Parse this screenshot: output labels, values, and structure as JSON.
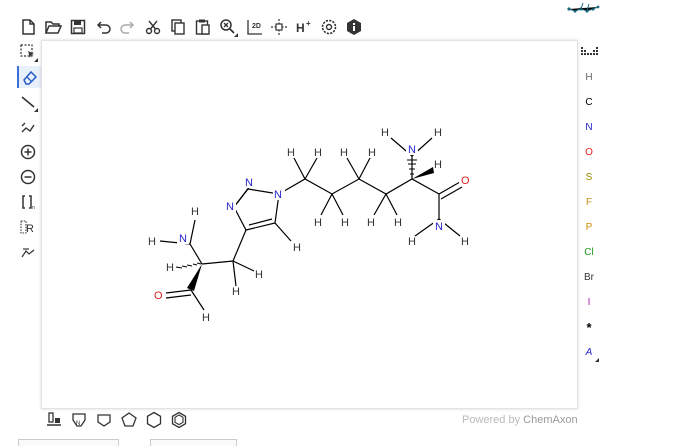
{
  "top_toolbar": {
    "buttons": [
      {
        "name": "new-document-icon"
      },
      {
        "name": "open-folder-icon"
      },
      {
        "name": "save-icon"
      },
      {
        "name": "undo-icon"
      },
      {
        "name": "redo-icon"
      },
      {
        "name": "cut-icon"
      },
      {
        "name": "copy-icon"
      },
      {
        "name": "paste-icon"
      },
      {
        "name": "zoom-icon"
      },
      {
        "name": "clean-2d-icon",
        "label": "2D"
      },
      {
        "name": "aromatize-icon"
      },
      {
        "name": "add-hydrogens-icon",
        "label": "H+"
      },
      {
        "name": "settings-icon"
      },
      {
        "name": "info-icon"
      }
    ]
  },
  "left_toolbar": {
    "tools": [
      {
        "name": "select-tool"
      },
      {
        "name": "erase-tool"
      },
      {
        "name": "single-bond-tool"
      },
      {
        "name": "chain-tool"
      },
      {
        "name": "increase-charge-tool"
      },
      {
        "name": "decrease-charge-tool"
      },
      {
        "name": "sgroup-tool",
        "label": "[ ]n"
      },
      {
        "name": "rgroup-tool",
        "label": "R"
      },
      {
        "name": "reaction-arrow-tool"
      }
    ]
  },
  "atom_palette": {
    "atoms": [
      {
        "symbol": "H",
        "color": "#666666"
      },
      {
        "symbol": "C",
        "color": "#000000"
      },
      {
        "symbol": "N",
        "color": "#2626cc"
      },
      {
        "symbol": "O",
        "color": "#e02020"
      },
      {
        "symbol": "S",
        "color": "#9a8a00"
      },
      {
        "symbol": "F",
        "color": "#c98d18"
      },
      {
        "symbol": "P",
        "color": "#d08a00"
      },
      {
        "symbol": "Cl",
        "color": "#1a9a1a"
      },
      {
        "symbol": "Br",
        "color": "#333333"
      },
      {
        "symbol": "I",
        "color": "#b020b0"
      },
      {
        "symbol": "*",
        "color": "#000000"
      },
      {
        "symbol": "A",
        "color": "#2626cc"
      }
    ]
  },
  "bottom_toolbar": {
    "templates": [
      {
        "name": "template-library-icon"
      },
      {
        "name": "benzene-template-icon"
      },
      {
        "name": "cyclopropane-template-icon"
      },
      {
        "name": "cyclopentane-template-icon"
      },
      {
        "name": "cyclohexane-template-icon"
      },
      {
        "name": "benzene-ring-template-icon"
      }
    ]
  },
  "footer": {
    "powered_by": "Powered by",
    "brand": "ChemAxon"
  },
  "molecule": {
    "atoms": {
      "N": "N",
      "O": "O",
      "H": "H"
    }
  }
}
